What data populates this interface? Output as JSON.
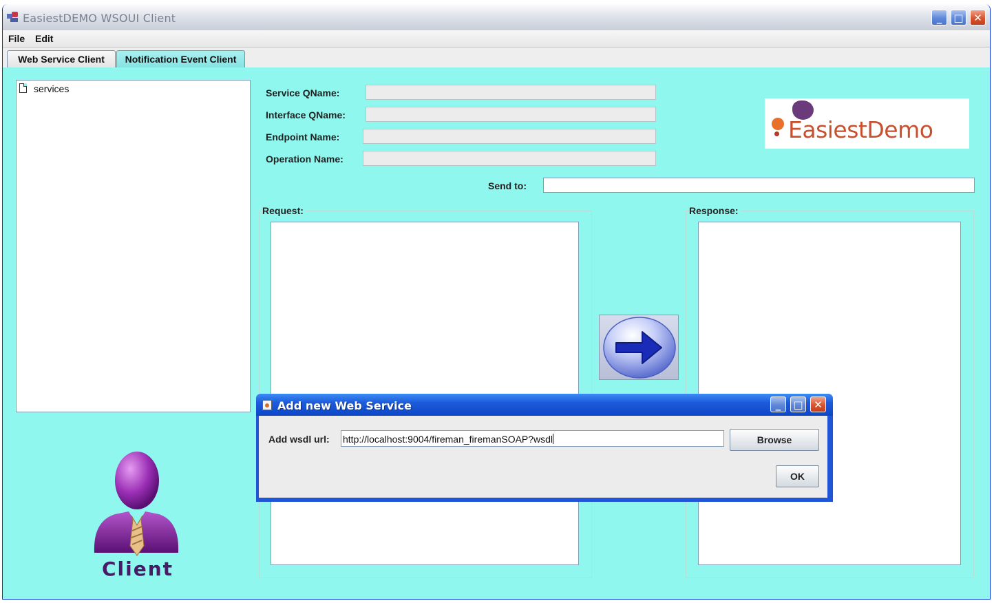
{
  "window": {
    "title": "EasiestDEMO WSOUI Client",
    "minimize_glyph": "_",
    "maximize_glyph": "□",
    "close_glyph": "✕"
  },
  "menu": {
    "items": [
      "File",
      "Edit"
    ]
  },
  "tabs": [
    {
      "label": "Web Service Client",
      "active": true
    },
    {
      "label": "Notification Event Client",
      "active": false
    }
  ],
  "tree": {
    "root_label": "services"
  },
  "fields": {
    "service_qname_label": "Service QName:",
    "service_qname_value": "",
    "interface_qname_label": "Interface QName:",
    "interface_qname_value": "",
    "endpoint_name_label": "Endpoint Name:",
    "endpoint_name_value": "",
    "operation_name_label": "Operation Name:",
    "operation_name_value": "",
    "send_to_label": "Send to:",
    "send_to_value": ""
  },
  "logo": {
    "text": "EasiestDemo"
  },
  "request": {
    "label": "Request:",
    "body": ""
  },
  "response": {
    "label": "Response:",
    "body": ""
  },
  "send_button": {
    "icon": "arrow-right-icon"
  },
  "client_figure": {
    "label": "Client",
    "icon": "user-icon"
  },
  "dialog": {
    "title": "Add new Web Service",
    "wsdl_label": "Add wsdl url:",
    "wsdl_value": "http://localhost:9004/fireman_firemanSOAP?wsdl",
    "browse_label": "Browse",
    "ok_label": "OK",
    "minimize_glyph": "_",
    "maximize_glyph": "□",
    "close_glyph": "✕"
  },
  "colors": {
    "content_bg": "#8ff7ee",
    "dialog_frame": "#1f55d6",
    "logo_accent": "#c8502e"
  }
}
